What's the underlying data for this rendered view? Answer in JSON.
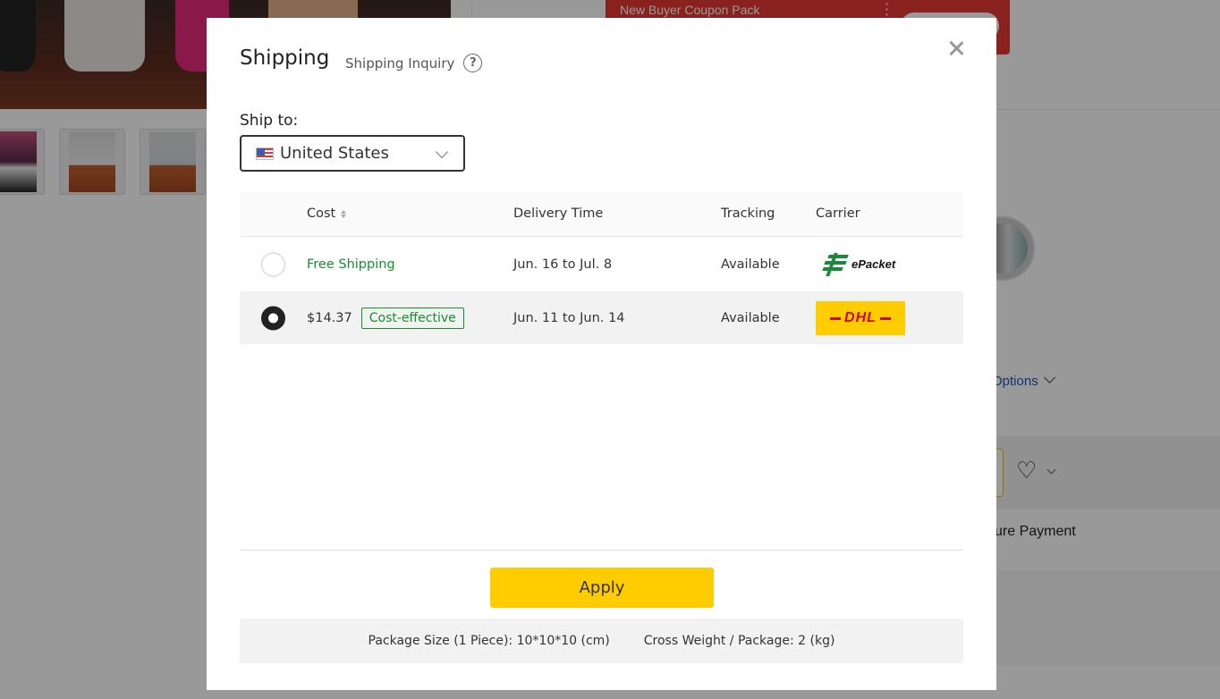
{
  "background": {
    "coupon_banner": "New Buyer Coupon Pack",
    "more_options": "Options",
    "secure_payment": "ure Payment"
  },
  "modal": {
    "title": "Shipping",
    "inquiry_label": "Shipping Inquiry",
    "help_glyph": "?",
    "ship_to_label": "Ship to:",
    "country": "United States",
    "table": {
      "headers": {
        "cost": "Cost",
        "delivery": "Delivery Time",
        "tracking": "Tracking",
        "carrier": "Carrier"
      },
      "rows": [
        {
          "selected": false,
          "cost": "Free Shipping",
          "badge": "",
          "delivery": "Jun. 16 to Jul. 8",
          "tracking": "Available",
          "carrier": "ePacket"
        },
        {
          "selected": true,
          "cost": "$14.37",
          "badge": "Cost-effective",
          "delivery": "Jun. 11 to Jun. 14",
          "tracking": "Available",
          "carrier": "DHL"
        }
      ]
    },
    "apply_label": "Apply",
    "package_size": "Package Size (1 Piece): 10*10*10 (cm)",
    "gross_weight": "Cross Weight / Package: 2 (kg)"
  },
  "colors": {
    "accent_yellow": "#ffcc00",
    "free_green": "#14912a",
    "dhl_red": "#d40511",
    "coupon_red": "#e53935"
  }
}
